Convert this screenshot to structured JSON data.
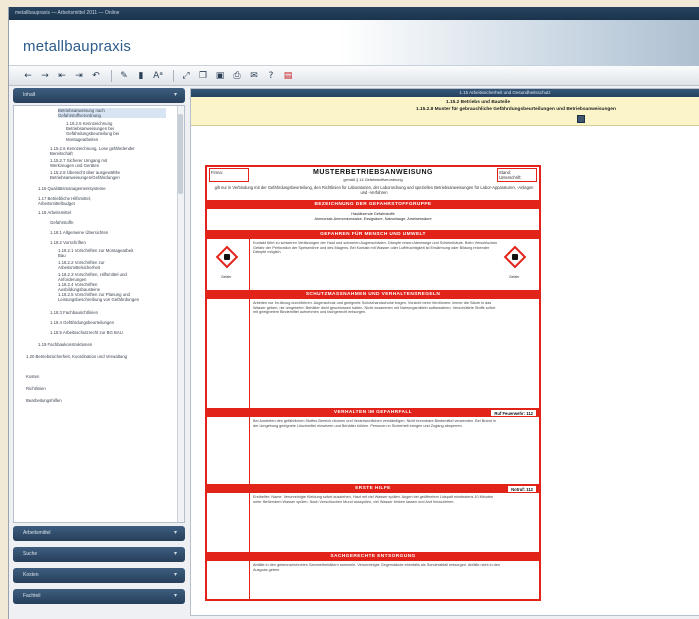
{
  "window": {
    "title": "metallbaupraxis — Arbeitsmittel 2011 — Online"
  },
  "header": {
    "brand": "metallbaupraxis"
  },
  "toolbar": {
    "icons": [
      "arrow-left-icon",
      "arrow-right-icon",
      "arrow-up-icon",
      "arrow-down-icon",
      "return-icon",
      "pen-icon",
      "column-icon",
      "text-size-icon",
      "expand-icon",
      "copy-icon",
      "save-icon",
      "print-icon",
      "mail-icon",
      "help-icon",
      "pdf-icon"
    ]
  },
  "sidebar": {
    "top_panel": {
      "label": "Inhalt"
    },
    "tree": [
      {
        "text": "Betriebsanweisung nach\nGefahrstoffverordnung",
        "sel": true
      },
      {
        "text": "1.15.2.5 Kennzeichnung\nBetriebsanweisungen bei\nGefährdungsbeurteilung bei\nMontagearbeiten"
      },
      {
        "text": "1.15.2.6 Kennzeichnung, Lose gefährdender\nBereitschaft"
      },
      {
        "text": "1.15.2.7 Sicherer Umgang mit\nWerkzeugen und Geräten"
      },
      {
        "text": "1.15.2.8 Übersicht über ausgewählte\nBetriebsanweisungen/Gefährdungen"
      },
      {
        "text": "1.16 Qualitätsmanagementsysteme"
      },
      {
        "text": "1.17 Betriebliche Hilfsmittel,\nArbeitsmittelbudget"
      },
      {
        "text": "1.18 Arbeitsmittel"
      },
      {
        "text": "Gefahrstoffe"
      },
      {
        "text": "1.18.1 Allgemeine Übersichten"
      },
      {
        "text": "1.18.2 Vorschriften"
      },
      {
        "text": "1.18.2.1 Vorschriften zur Montagearbeit\nBau"
      },
      {
        "text": "1.18.2.2 Vorschriften zur\nArbeitsmittelsicherheit"
      },
      {
        "text": "1.18.2.3 Vorschriften, Hilfsmittel und\nAnforderungen"
      },
      {
        "text": "1.18.2.4 Vorschriften\nAusbildungsbausteine"
      },
      {
        "text": "1.18.2.5 Vorschriften zur Planung und\nLeistungsbeschreibung von Gefährdungen"
      },
      {
        "text": "1.18.3 Fachbaurichtlinien"
      },
      {
        "text": "1.18.4 Gefährdungsbeurteilungen"
      },
      {
        "text": "1.18.5 Arbeitsschutzrecht zur BG BAU"
      },
      {
        "text": "1.19 Fachbaukonstruktionen"
      },
      {
        "text": "1.20 Betriebssicherheit, Koordination und Verwaltung"
      },
      {
        "text": "Kosten"
      },
      {
        "text": "Richtlinien"
      },
      {
        "text": "Bearbeitungshilfen"
      }
    ],
    "panels": [
      {
        "label": "Arbeitsmittel"
      },
      {
        "label": "Suche"
      },
      {
        "label": "Kosten"
      },
      {
        "label": "Fachteil"
      }
    ]
  },
  "document": {
    "header_bar": "1.15 Arbeitssicherheit und Gesundheitsschutz",
    "sub1": "1.15.2 Betriebs und Bauteile",
    "sub2": "1.15.2.8 Muster für gebrauchliche Gefährdungsbeurteilungen und Betriebsanweisungen"
  },
  "sheet": {
    "firma": "Firma:",
    "title": "MUSTERBETRIEBSANWEISUNG",
    "subtitle": "gemäß § 14 Gefahrstoffverordnung",
    "stand": "Stand:\nUnterschrift:",
    "intro": "gilt nur in Verbindung mit der Gefährdungsbeurteilung, den Richtlinien für Laboratorien, der Laborordnung und speziellen Betriebsanweisungen für Labor-Apparaturen, -Anlagen und -Verfahren",
    "sections": [
      {
        "band": "BEZEICHNUNG DER GEFAHRSTOFFGRUPPE",
        "text": "Hautätzende Gefahrstoffe\nAmmoniak-Ammoniumsalze, Essigsäure, Natronlauge, Ameisensäure"
      },
      {
        "band": "GEFAHREN FÜR MENSCH UND UMWELT",
        "text": "Kontakt führt zu schweren Verätzungen der Haut und schweren Augenschäden. Dämpfe reizen Atemwege und Schleimhäute. Beim Verschlucken Gefahr der Perforation der Speiseröhre und des Magens. Bei Kontakt mit Wasser oder Luftfeuchtigkeit ist Erwärmung oder Bildung reizender Dämpfe möglich."
      },
      {
        "band": "SCHUTZMASSNAHMEN UND VERHALTENSREGELN",
        "text": "Arbeiten nur im Abzug durchführen. Augenschutz und geeignete Schutzhandschuhe tragen. Vorsicht beim Verdünnen: immer die Säure in das Wasser geben, nie umgekehrt. Behälter dicht geschlossen halten. Nicht zusammen mit Nahrungsmitteln aufbewahren. Verschüttete Stoffe sofort mit geeignetem Bindemittel aufnehmen und fachgerecht entsorgen."
      },
      {
        "band": "VERHALTEN IM GEFAHRFALL",
        "tag": "Ruf Feuerwehr: 112",
        "text": "Bei Austreten des gefährlichen Stoffes Bereich räumen und Verantwortlichen verständigen. Nicht brennbare Bindemittel verwenden. Bei Brand in der Umgebung geeignete Löschmittel einsetzen und Behälter kühlen. Personen in Sicherheit bringen und Zugang absperren."
      },
      {
        "band": "ERSTE HILFE",
        "tag": "Notruf: 112",
        "text": "Ersthelfer: Name. Verunreinigte Kleidung sofort ausziehen, Haut mit viel Wasser spülen. Augen bei geöffnetem Lidspalt mindestens 10 Minuten unter fließendem Wasser spülen. Nach Verschlucken Mund ausspülen, viel Wasser trinken lassen und Arzt hinzuziehen."
      },
      {
        "band": "SACHGERECHTE ENTSORGUNG",
        "text": "Abfälle in den gekennzeichneten Sammelbehältern sammeln. Verunreinigte Gegenstände ebenfalls als Sonderabfall entsorgen. Abfälle nicht in den Ausguss geben."
      }
    ],
    "ghs_left": "Gefahr",
    "ghs_right": "Gefahr"
  }
}
